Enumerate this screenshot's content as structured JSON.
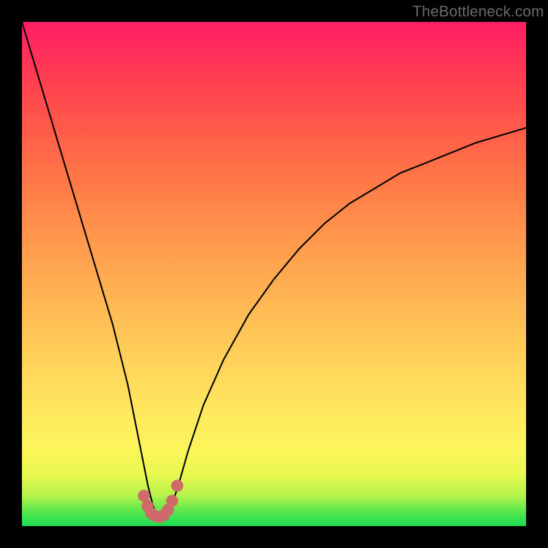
{
  "watermark": "TheBottleneck.com",
  "chart_data": {
    "type": "line",
    "title": "",
    "xlabel": "",
    "ylabel": "",
    "xlim": [
      0,
      100
    ],
    "ylim": [
      0,
      100
    ],
    "curve_note": "V-shaped bottleneck curve with minimum near x≈27; y estimated as percent of plot height from bottom",
    "series": [
      {
        "name": "bottleneck-curve",
        "x": [
          0,
          3,
          6,
          9,
          12,
          15,
          18,
          21,
          23,
          25,
          26,
          27,
          28,
          29,
          30,
          31,
          33,
          36,
          40,
          45,
          50,
          55,
          60,
          65,
          70,
          75,
          80,
          85,
          90,
          95,
          100
        ],
        "y": [
          100,
          90,
          80,
          70,
          60,
          50,
          40,
          28,
          18,
          8,
          4,
          2,
          2,
          3,
          5,
          8,
          15,
          24,
          33,
          42,
          49,
          55,
          60,
          64,
          67,
          70,
          72,
          74,
          76,
          77.5,
          79
        ]
      }
    ],
    "markers": {
      "note": "salmon dotted cluster near curve minimum",
      "points": [
        {
          "x": 24.2,
          "y": 6.0
        },
        {
          "x": 24.9,
          "y": 4.0
        },
        {
          "x": 25.6,
          "y": 2.6
        },
        {
          "x": 26.4,
          "y": 2.0
        },
        {
          "x": 27.3,
          "y": 1.8
        },
        {
          "x": 28.2,
          "y": 2.2
        },
        {
          "x": 29.0,
          "y": 3.2
        },
        {
          "x": 29.8,
          "y": 5.0
        },
        {
          "x": 30.8,
          "y": 8.0
        }
      ],
      "radius_pct": 1.2,
      "color": "#cf6a6a"
    },
    "gradient_stops": [
      {
        "pos": 0,
        "color": "#1bdc54"
      },
      {
        "pos": 10,
        "color": "#e6f84e"
      },
      {
        "pos": 50,
        "color": "#ffac50"
      },
      {
        "pos": 100,
        "color": "#ff1f64"
      }
    ]
  }
}
